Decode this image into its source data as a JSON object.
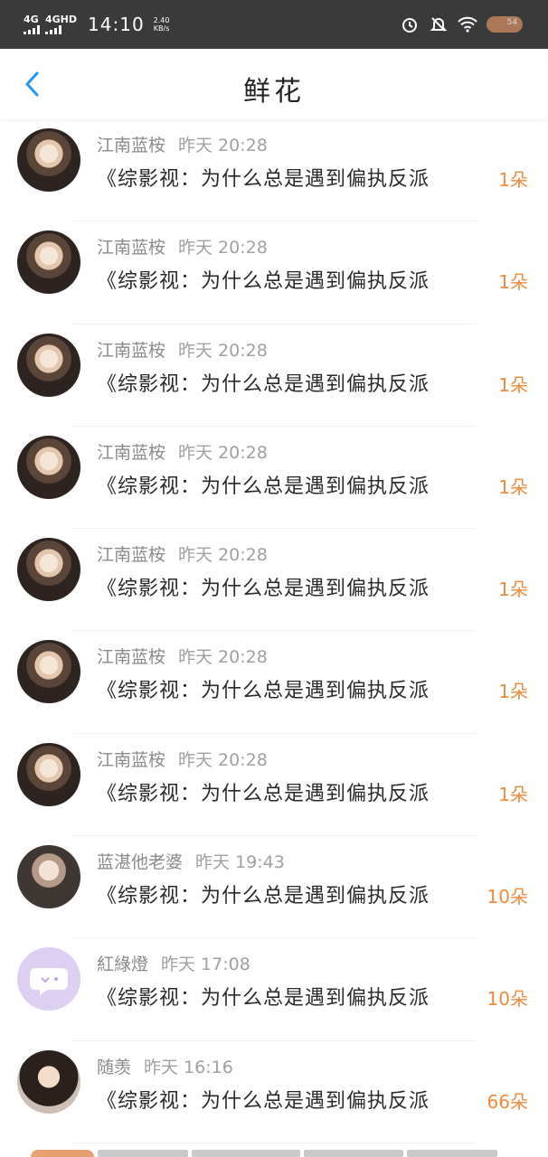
{
  "status_bar": {
    "network1": "4G",
    "network2": "4GHD",
    "time": "14:10",
    "speed_value": "2.40",
    "speed_unit": "KB/s",
    "battery": "54"
  },
  "header": {
    "title": "鲜花",
    "back_icon": "chevron-left-icon"
  },
  "colors": {
    "accent_blue": "#2196f3",
    "count_orange": "#f08a3c",
    "status_bar_bg": "#3a3a3a"
  },
  "items": [
    {
      "user": "江南蓝桉",
      "time": "昨天 20:28",
      "title": "《综影视：为什么总是遇到偏执反派",
      "count": "1朵"
    },
    {
      "user": "江南蓝桉",
      "time": "昨天 20:28",
      "title": "《综影视：为什么总是遇到偏执反派",
      "count": "1朵"
    },
    {
      "user": "江南蓝桉",
      "time": "昨天 20:28",
      "title": "《综影视：为什么总是遇到偏执反派",
      "count": "1朵"
    },
    {
      "user": "江南蓝桉",
      "time": "昨天 20:28",
      "title": "《综影视：为什么总是遇到偏执反派",
      "count": "1朵"
    },
    {
      "user": "江南蓝桉",
      "time": "昨天 20:28",
      "title": "《综影视：为什么总是遇到偏执反派",
      "count": "1朵"
    },
    {
      "user": "江南蓝桉",
      "time": "昨天 20:28",
      "title": "《综影视：为什么总是遇到偏执反派",
      "count": "1朵"
    },
    {
      "user": "江南蓝桉",
      "time": "昨天 20:28",
      "title": "《综影视：为什么总是遇到偏执反派",
      "count": "1朵"
    },
    {
      "user": "蓝湛他老婆",
      "time": "昨天 19:43",
      "title": "《综影视：为什么总是遇到偏执反派",
      "count": "10朵"
    },
    {
      "user": "紅綠燈",
      "time": "昨天 17:08",
      "title": "《综影视：为什么总是遇到偏执反派",
      "count": "10朵"
    },
    {
      "user": "随羡",
      "time": "昨天 16:16",
      "title": "《综影视：为什么总是遇到偏执反派",
      "count": "66朵"
    }
  ]
}
